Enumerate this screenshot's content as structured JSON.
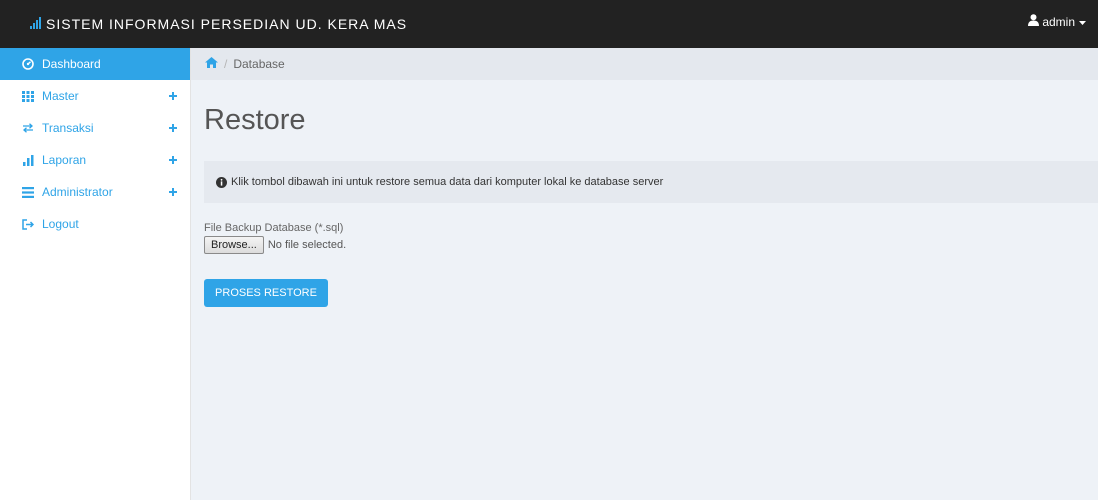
{
  "app": {
    "title": "SISTEM INFORMASI PERSEDIAN UD. KERA MAS",
    "brand_icon": "bar-chart-icon"
  },
  "user_menu": {
    "label": "admin",
    "icon": "user-icon"
  },
  "sidebar": {
    "items": [
      {
        "label": "Dashboard",
        "icon": "dashboard-icon",
        "active": true
      },
      {
        "label": "Master",
        "icon": "grid-icon",
        "expandable": true
      },
      {
        "label": "Transaksi",
        "icon": "exchange-icon",
        "expandable": true
      },
      {
        "label": "Laporan",
        "icon": "bar-chart-icon",
        "expandable": true
      },
      {
        "label": "Administrator",
        "icon": "list-icon",
        "expandable": true
      },
      {
        "label": "Logout",
        "icon": "logout-icon"
      }
    ]
  },
  "breadcrumb": {
    "home_icon": "home-icon",
    "separator": "/",
    "current": "Database"
  },
  "page": {
    "title": "Restore",
    "info_text": "Klik tombol dibawah ini untuk restore semua data dari komputer lokal ke database server",
    "info_icon": "info-circle-icon",
    "file_label": "File Backup Database (*.sql)",
    "browse_label": "Browse...",
    "file_status": "No file selected.",
    "submit_label": "PROSES RESTORE"
  },
  "colors": {
    "accent": "#2fa4e7",
    "navbar": "#222222",
    "content_bg": "#eef2f7"
  }
}
